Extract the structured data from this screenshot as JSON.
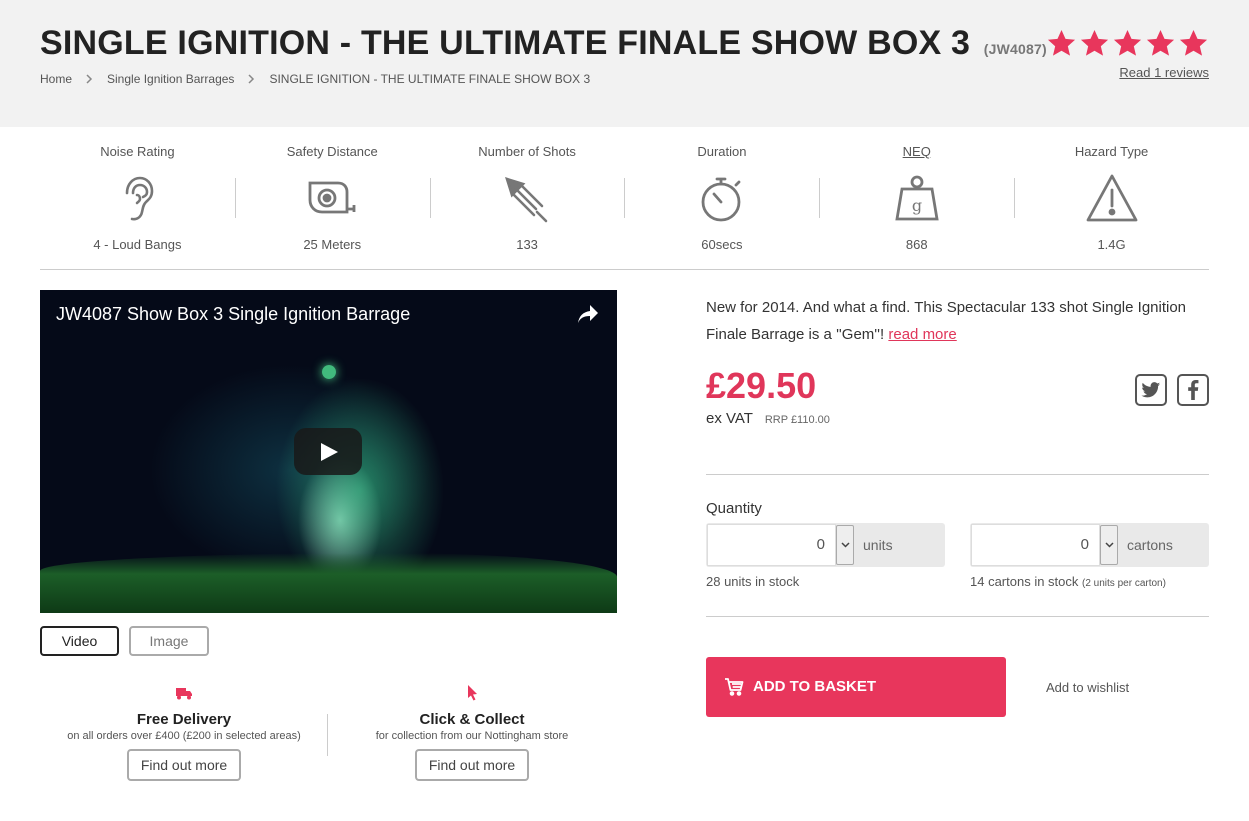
{
  "header": {
    "title": "SINGLE IGNITION - THE ULTIMATE FINALE SHOW BOX 3",
    "code": "(JW4087)",
    "rating_stars": 5,
    "star_color": "#e8365c",
    "reviews_link": "Read 1 reviews",
    "breadcrumb": [
      "Home",
      "Single Ignition Barrages",
      "SINGLE IGNITION - THE ULTIMATE FINALE SHOW BOX 3"
    ]
  },
  "specs": [
    {
      "label": "Noise Rating",
      "value": "4 - Loud Bangs",
      "icon": "ear-icon"
    },
    {
      "label": "Safety Distance",
      "value": "25 Meters",
      "icon": "tape-measure-icon"
    },
    {
      "label": "Number of Shots",
      "value": "133",
      "icon": "rocket-icon"
    },
    {
      "label": "Duration",
      "value": "60secs",
      "icon": "stopwatch-icon"
    },
    {
      "label": "NEQ",
      "value": "868",
      "icon": "weight-icon"
    },
    {
      "label": "Hazard Type",
      "value": "1.4G",
      "icon": "warning-icon"
    }
  ],
  "video": {
    "title": "JW4087 Show Box 3 Single Ignition Barrage"
  },
  "media_tabs": {
    "video": "Video",
    "image": "Image"
  },
  "perks": [
    {
      "icon": "truck-icon",
      "title": "Free Delivery",
      "subtitle": "on all orders over £400 (£200 in selected areas)",
      "button": "Find out more"
    },
    {
      "icon": "cursor-icon",
      "title": "Click & Collect",
      "subtitle": "for collection from our Nottingham store",
      "button": "Find out more"
    }
  ],
  "product": {
    "description": "New for 2014. And what a find. This Spectacular 133 shot Single Ignition Finale Barrage is a ''Gem''!",
    "read_more": "read more",
    "price": "£29.50",
    "vat_label": "ex VAT",
    "rrp": "RRP £110.00",
    "accent_color": "#e8365c"
  },
  "quantity": {
    "label": "Quantity",
    "units": {
      "value": "0",
      "unit_label": "units",
      "stock": "28 units in stock"
    },
    "cartons": {
      "value": "0",
      "unit_label": "cartons",
      "stock": "14 cartons in stock",
      "stock_note": "(2 units per carton)"
    }
  },
  "actions": {
    "add_to_basket": "ADD TO BASKET",
    "wishlist": "Add to wishlist"
  }
}
